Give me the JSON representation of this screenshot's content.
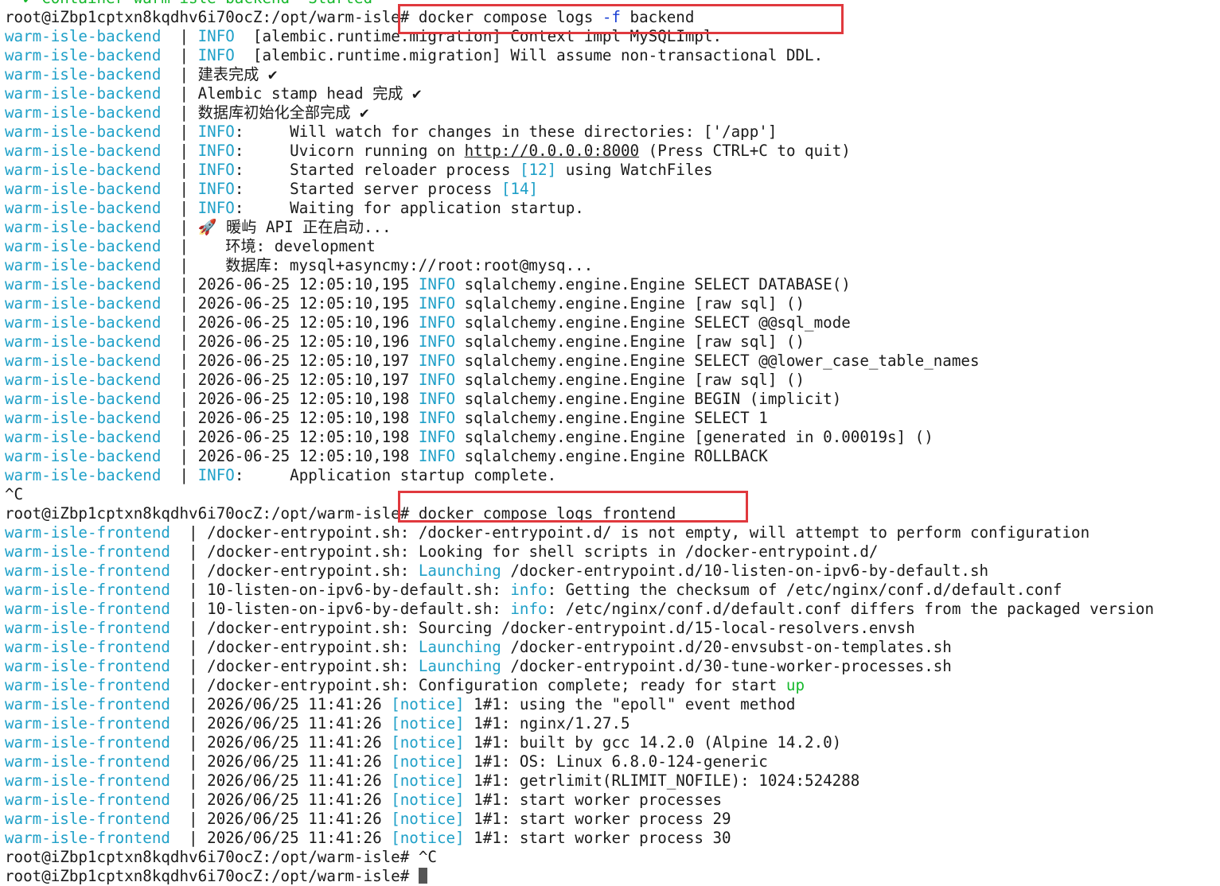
{
  "terminal": {
    "lines": [
      {
        "segments": [
          {
            "t": "  ✔ Container warm-isle-backend  Started",
            "c": "green"
          }
        ]
      },
      {
        "segments": [
          {
            "t": "root@iZbp1cptxn8kqdhv6i70ocZ:/opt/warm-isle# docker compose logs "
          },
          {
            "t": "-f",
            "c": "blue"
          },
          {
            "t": " backend"
          }
        ]
      },
      {
        "segments": [
          {
            "t": "warm-isle-backend",
            "c": "cyan"
          },
          {
            "t": "  | "
          },
          {
            "t": "INFO",
            "c": "cyan"
          },
          {
            "t": "  [alembic.runtime.migration] Context impl MySQLImpl."
          }
        ]
      },
      {
        "segments": [
          {
            "t": "warm-isle-backend",
            "c": "cyan"
          },
          {
            "t": "  | "
          },
          {
            "t": "INFO",
            "c": "cyan"
          },
          {
            "t": "  [alembic.runtime.migration] Will assume non-transactional DDL."
          }
        ]
      },
      {
        "segments": [
          {
            "t": "warm-isle-backend",
            "c": "cyan"
          },
          {
            "t": "  | 建表完成 ✔"
          }
        ]
      },
      {
        "segments": [
          {
            "t": "warm-isle-backend",
            "c": "cyan"
          },
          {
            "t": "  | Alembic stamp head 完成 ✔"
          }
        ]
      },
      {
        "segments": [
          {
            "t": "warm-isle-backend",
            "c": "cyan"
          },
          {
            "t": "  | 数据库初始化全部完成 ✔"
          }
        ]
      },
      {
        "segments": [
          {
            "t": "warm-isle-backend",
            "c": "cyan"
          },
          {
            "t": "  | "
          },
          {
            "t": "INFO",
            "c": "cyan"
          },
          {
            "t": ":     Will watch for changes in these directories: ['/app']"
          }
        ]
      },
      {
        "segments": [
          {
            "t": "warm-isle-backend",
            "c": "cyan"
          },
          {
            "t": "  | "
          },
          {
            "t": "INFO",
            "c": "cyan"
          },
          {
            "t": ":     Uvicorn running on "
          },
          {
            "t": "http://0.0.0.0:8000",
            "c": "link"
          },
          {
            "t": " (Press CTRL+C to quit)"
          }
        ]
      },
      {
        "segments": [
          {
            "t": "warm-isle-backend",
            "c": "cyan"
          },
          {
            "t": "  | "
          },
          {
            "t": "INFO",
            "c": "cyan"
          },
          {
            "t": ":     Started reloader process "
          },
          {
            "t": "[12]",
            "c": "cyan"
          },
          {
            "t": " using WatchFiles"
          }
        ]
      },
      {
        "segments": [
          {
            "t": "warm-isle-backend",
            "c": "cyan"
          },
          {
            "t": "  | "
          },
          {
            "t": "INFO",
            "c": "cyan"
          },
          {
            "t": ":     Started server process "
          },
          {
            "t": "[14]",
            "c": "cyan"
          }
        ]
      },
      {
        "segments": [
          {
            "t": "warm-isle-backend",
            "c": "cyan"
          },
          {
            "t": "  | "
          },
          {
            "t": "INFO",
            "c": "cyan"
          },
          {
            "t": ":     Waiting for application startup."
          }
        ]
      },
      {
        "segments": [
          {
            "t": "warm-isle-backend",
            "c": "cyan"
          },
          {
            "t": "  | 🚀 暖屿 API 正在启动..."
          }
        ]
      },
      {
        "segments": [
          {
            "t": "warm-isle-backend",
            "c": "cyan"
          },
          {
            "t": "  |    环境: development"
          }
        ]
      },
      {
        "segments": [
          {
            "t": "warm-isle-backend",
            "c": "cyan"
          },
          {
            "t": "  |    数据库: mysql+asyncmy://root:root@mysq..."
          }
        ]
      },
      {
        "segments": [
          {
            "t": "warm-isle-backend",
            "c": "cyan"
          },
          {
            "t": "  | 2026-06-25 12:05:10,195 "
          },
          {
            "t": "INFO",
            "c": "cyan"
          },
          {
            "t": " sqlalchemy.engine.Engine SELECT DATABASE()"
          }
        ]
      },
      {
        "segments": [
          {
            "t": "warm-isle-backend",
            "c": "cyan"
          },
          {
            "t": "  | 2026-06-25 12:05:10,195 "
          },
          {
            "t": "INFO",
            "c": "cyan"
          },
          {
            "t": " sqlalchemy.engine.Engine [raw sql] ()"
          }
        ]
      },
      {
        "segments": [
          {
            "t": "warm-isle-backend",
            "c": "cyan"
          },
          {
            "t": "  | 2026-06-25 12:05:10,196 "
          },
          {
            "t": "INFO",
            "c": "cyan"
          },
          {
            "t": " sqlalchemy.engine.Engine SELECT @@sql_mode"
          }
        ]
      },
      {
        "segments": [
          {
            "t": "warm-isle-backend",
            "c": "cyan"
          },
          {
            "t": "  | 2026-06-25 12:05:10,196 "
          },
          {
            "t": "INFO",
            "c": "cyan"
          },
          {
            "t": " sqlalchemy.engine.Engine [raw sql] ()"
          }
        ]
      },
      {
        "segments": [
          {
            "t": "warm-isle-backend",
            "c": "cyan"
          },
          {
            "t": "  | 2026-06-25 12:05:10,197 "
          },
          {
            "t": "INFO",
            "c": "cyan"
          },
          {
            "t": " sqlalchemy.engine.Engine SELECT @@lower_case_table_names"
          }
        ]
      },
      {
        "segments": [
          {
            "t": "warm-isle-backend",
            "c": "cyan"
          },
          {
            "t": "  | 2026-06-25 12:05:10,197 "
          },
          {
            "t": "INFO",
            "c": "cyan"
          },
          {
            "t": " sqlalchemy.engine.Engine [raw sql] ()"
          }
        ]
      },
      {
        "segments": [
          {
            "t": "warm-isle-backend",
            "c": "cyan"
          },
          {
            "t": "  | 2026-06-25 12:05:10,198 "
          },
          {
            "t": "INFO",
            "c": "cyan"
          },
          {
            "t": " sqlalchemy.engine.Engine BEGIN (implicit)"
          }
        ]
      },
      {
        "segments": [
          {
            "t": "warm-isle-backend",
            "c": "cyan"
          },
          {
            "t": "  | 2026-06-25 12:05:10,198 "
          },
          {
            "t": "INFO",
            "c": "cyan"
          },
          {
            "t": " sqlalchemy.engine.Engine SELECT 1"
          }
        ]
      },
      {
        "segments": [
          {
            "t": "warm-isle-backend",
            "c": "cyan"
          },
          {
            "t": "  | 2026-06-25 12:05:10,198 "
          },
          {
            "t": "INFO",
            "c": "cyan"
          },
          {
            "t": " sqlalchemy.engine.Engine [generated in 0.00019s] ()"
          }
        ]
      },
      {
        "segments": [
          {
            "t": "warm-isle-backend",
            "c": "cyan"
          },
          {
            "t": "  | 2026-06-25 12:05:10,198 "
          },
          {
            "t": "INFO",
            "c": "cyan"
          },
          {
            "t": " sqlalchemy.engine.Engine ROLLBACK"
          }
        ]
      },
      {
        "segments": [
          {
            "t": "warm-isle-backend",
            "c": "cyan"
          },
          {
            "t": "  | "
          },
          {
            "t": "INFO",
            "c": "cyan"
          },
          {
            "t": ":     Application startup complete."
          }
        ]
      },
      {
        "segments": [
          {
            "t": "^C"
          }
        ]
      },
      {
        "segments": [
          {
            "t": "root@iZbp1cptxn8kqdhv6i70ocZ:/opt/warm-isle# docker compose logs frontend"
          }
        ]
      },
      {
        "segments": [
          {
            "t": "warm-isle-frontend",
            "c": "cyan"
          },
          {
            "t": "  | /docker-entrypoint.sh: /docker-entrypoint.d/ is not empty, will attempt to perform configuration"
          }
        ]
      },
      {
        "segments": [
          {
            "t": "warm-isle-frontend",
            "c": "cyan"
          },
          {
            "t": "  | /docker-entrypoint.sh: Looking for shell scripts in /docker-entrypoint.d/"
          }
        ]
      },
      {
        "segments": [
          {
            "t": "warm-isle-frontend",
            "c": "cyan"
          },
          {
            "t": "  | /docker-entrypoint.sh: "
          },
          {
            "t": "Launching",
            "c": "cyan"
          },
          {
            "t": " /docker-entrypoint.d/10-listen-on-ipv6-by-default.sh"
          }
        ]
      },
      {
        "segments": [
          {
            "t": "warm-isle-frontend",
            "c": "cyan"
          },
          {
            "t": "  | 10-listen-on-ipv6-by-default.sh: "
          },
          {
            "t": "info",
            "c": "cyan"
          },
          {
            "t": ": Getting the checksum of /etc/nginx/conf.d/default.conf"
          }
        ]
      },
      {
        "segments": [
          {
            "t": "warm-isle-frontend",
            "c": "cyan"
          },
          {
            "t": "  | 10-listen-on-ipv6-by-default.sh: "
          },
          {
            "t": "info",
            "c": "cyan"
          },
          {
            "t": ": /etc/nginx/conf.d/default.conf differs from the packaged version"
          }
        ]
      },
      {
        "segments": [
          {
            "t": "warm-isle-frontend",
            "c": "cyan"
          },
          {
            "t": "  | /docker-entrypoint.sh: Sourcing /docker-entrypoint.d/15-local-resolvers.envsh"
          }
        ]
      },
      {
        "segments": [
          {
            "t": "warm-isle-frontend",
            "c": "cyan"
          },
          {
            "t": "  | /docker-entrypoint.sh: "
          },
          {
            "t": "Launching",
            "c": "cyan"
          },
          {
            "t": " /docker-entrypoint.d/20-envsubst-on-templates.sh"
          }
        ]
      },
      {
        "segments": [
          {
            "t": "warm-isle-frontend",
            "c": "cyan"
          },
          {
            "t": "  | /docker-entrypoint.sh: "
          },
          {
            "t": "Launching",
            "c": "cyan"
          },
          {
            "t": " /docker-entrypoint.d/30-tune-worker-processes.sh"
          }
        ]
      },
      {
        "segments": [
          {
            "t": "warm-isle-frontend",
            "c": "cyan"
          },
          {
            "t": "  | /docker-entrypoint.sh: Configuration complete; ready for start "
          },
          {
            "t": "up",
            "c": "green"
          }
        ]
      },
      {
        "segments": [
          {
            "t": "warm-isle-frontend",
            "c": "cyan"
          },
          {
            "t": "  | 2026/06/25 11:41:26 "
          },
          {
            "t": "[notice]",
            "c": "cyan"
          },
          {
            "t": " 1#1: using the \"epoll\" event method"
          }
        ]
      },
      {
        "segments": [
          {
            "t": "warm-isle-frontend",
            "c": "cyan"
          },
          {
            "t": "  | 2026/06/25 11:41:26 "
          },
          {
            "t": "[notice]",
            "c": "cyan"
          },
          {
            "t": " 1#1: nginx/1.27.5"
          }
        ]
      },
      {
        "segments": [
          {
            "t": "warm-isle-frontend",
            "c": "cyan"
          },
          {
            "t": "  | 2026/06/25 11:41:26 "
          },
          {
            "t": "[notice]",
            "c": "cyan"
          },
          {
            "t": " 1#1: built by gcc 14.2.0 (Alpine 14.2.0)"
          }
        ]
      },
      {
        "segments": [
          {
            "t": "warm-isle-frontend",
            "c": "cyan"
          },
          {
            "t": "  | 2026/06/25 11:41:26 "
          },
          {
            "t": "[notice]",
            "c": "cyan"
          },
          {
            "t": " 1#1: OS: Linux 6.8.0-124-generic"
          }
        ]
      },
      {
        "segments": [
          {
            "t": "warm-isle-frontend",
            "c": "cyan"
          },
          {
            "t": "  | 2026/06/25 11:41:26 "
          },
          {
            "t": "[notice]",
            "c": "cyan"
          },
          {
            "t": " 1#1: getrlimit(RLIMIT_NOFILE): 1024:524288"
          }
        ]
      },
      {
        "segments": [
          {
            "t": "warm-isle-frontend",
            "c": "cyan"
          },
          {
            "t": "  | 2026/06/25 11:41:26 "
          },
          {
            "t": "[notice]",
            "c": "cyan"
          },
          {
            "t": " 1#1: start worker processes"
          }
        ]
      },
      {
        "segments": [
          {
            "t": "warm-isle-frontend",
            "c": "cyan"
          },
          {
            "t": "  | 2026/06/25 11:41:26 "
          },
          {
            "t": "[notice]",
            "c": "cyan"
          },
          {
            "t": " 1#1: start worker process 29"
          }
        ]
      },
      {
        "segments": [
          {
            "t": "warm-isle-frontend",
            "c": "cyan"
          },
          {
            "t": "  | 2026/06/25 11:41:26 "
          },
          {
            "t": "[notice]",
            "c": "cyan"
          },
          {
            "t": " 1#1: start worker process 30"
          }
        ]
      },
      {
        "segments": [
          {
            "t": "root@iZbp1cptxn8kqdhv6i70ocZ:/opt/warm-isle# ^C"
          }
        ]
      },
      {
        "segments": [
          {
            "t": "root@iZbp1cptxn8kqdhv6i70ocZ:/opt/warm-isle# "
          }
        ],
        "cursor": true
      }
    ]
  }
}
